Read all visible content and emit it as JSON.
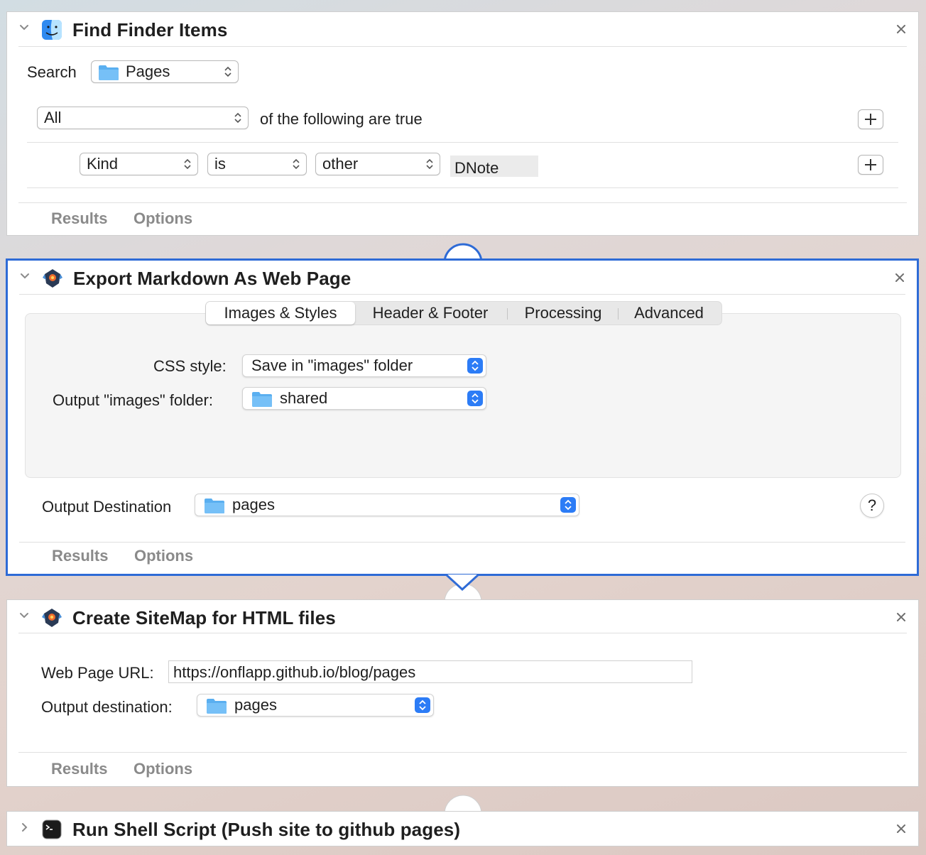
{
  "actions": [
    {
      "title": "Find Finder Items",
      "search_label": "Search",
      "search_location": "Pages",
      "match_mode": "All",
      "match_suffix": "of the following are true",
      "condition": {
        "attribute": "Kind",
        "operator": "is",
        "value_type": "other",
        "value": "DNote"
      },
      "footer": {
        "results": "Results",
        "options": "Options"
      }
    },
    {
      "title": "Export Markdown As Web Page",
      "tabs": [
        "Images & Styles",
        "Header & Footer",
        "Processing",
        "Advanced"
      ],
      "active_tab": "Images & Styles",
      "css_style_label": "CSS style:",
      "css_style_value": "Save in \"images\" folder",
      "images_folder_label": "Output \"images\" folder:",
      "images_folder_value": "shared",
      "dest_label": "Output Destination",
      "dest_value": "pages",
      "help": "?",
      "footer": {
        "results": "Results",
        "options": "Options"
      }
    },
    {
      "title": "Create SiteMap for HTML files",
      "url_label": "Web Page URL:",
      "url_value": "https://onflapp.github.io/blog/pages",
      "dest_label": "Output destination:",
      "dest_value": "pages",
      "footer": {
        "results": "Results",
        "options": "Options"
      }
    },
    {
      "title": "Run Shell Script (Push site to github pages)"
    }
  ],
  "colors": {
    "selection": "#2e6bd6",
    "popup_button": "#2c7cf6",
    "folder": "#5aaff0"
  },
  "icons": [
    "finder-icon",
    "markdown-export-icon",
    "terminal-icon",
    "close-icon",
    "chevron-down-icon",
    "chevron-right-icon",
    "plus-icon",
    "folder-icon",
    "popup-arrows-icon"
  ]
}
